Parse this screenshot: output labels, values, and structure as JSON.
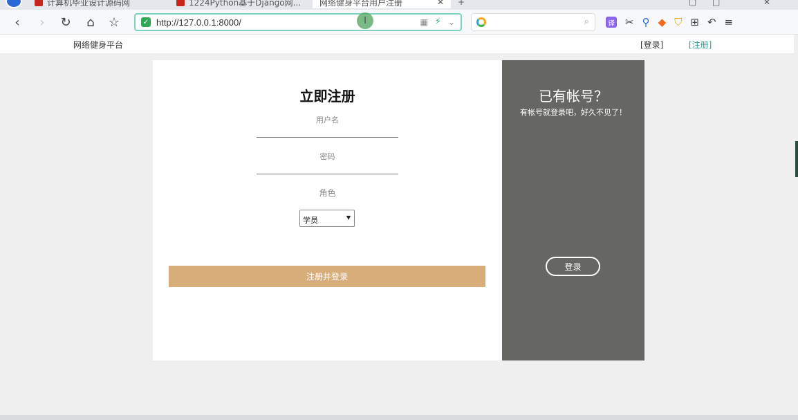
{
  "browser": {
    "tabs": [
      {
        "label": "计算机毕业设计源码网"
      },
      {
        "label": "1224Python基于Django网..."
      },
      {
        "label": "网络健身平台用户注册"
      }
    ],
    "address": {
      "url": "http://127.0.0.1:8000/"
    },
    "search": {
      "placeholder": ""
    }
  },
  "site": {
    "title": "网络健身平台",
    "nav_login": "[登录]",
    "nav_register": "[注册]"
  },
  "form": {
    "heading": "立即注册",
    "username_label": "用户名",
    "password_label": "密码",
    "role_label": "角色",
    "role_selected": "学员",
    "submit_label": "注册并登录"
  },
  "side": {
    "heading": "已有帐号？",
    "subtitle": "有帐号就登录吧，好久不见了！",
    "login_button": "登录"
  },
  "colors": {
    "accent_button": "#d7ae7a",
    "side_panel": "#666663",
    "address_border": "#7ad2bf"
  }
}
